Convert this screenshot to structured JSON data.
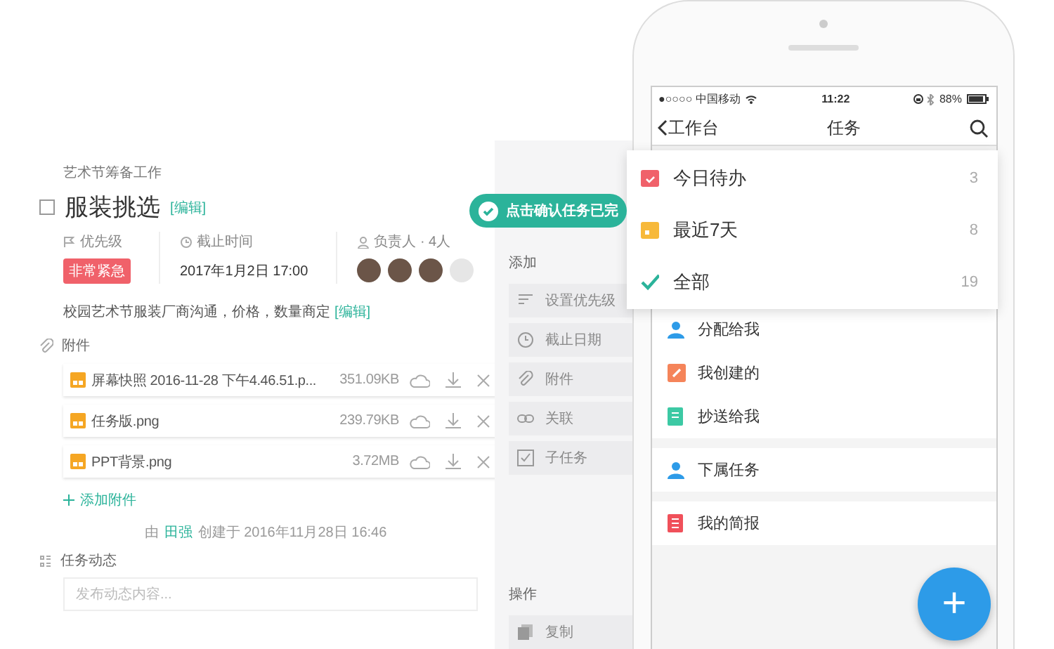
{
  "task_detail": {
    "breadcrumb": "艺术节筹备工作",
    "title": "服装挑选",
    "title_edit": "[编辑]",
    "completed": false,
    "fields": [
      {
        "kind": "priority",
        "label": "优先级",
        "value": "非常紧急"
      },
      {
        "kind": "deadline",
        "label": "截止时间",
        "value": "2017年1月2日 17:00"
      },
      {
        "kind": "assignees",
        "label": "负责人 · 4人",
        "avatars": [
          {
            "kind": "photo"
          },
          {
            "kind": "photo"
          },
          {
            "kind": "photo"
          },
          {
            "kind": "more"
          }
        ]
      }
    ],
    "description": "校园艺术节服装厂商沟通，价格，数量商定",
    "description_edit": "[编辑]",
    "attachments_label": "附件",
    "attachments": [
      {
        "name": "屏幕快照 2016-11-28 下午4.46.51.p...",
        "size": "351.09KB"
      },
      {
        "name": "任务版.png",
        "size": "239.79KB"
      },
      {
        "name": "PPT背景.png",
        "size": "3.72MB"
      }
    ],
    "add_attachment": "添加附件",
    "created_by": {
      "prefix": "由",
      "creator": "田强",
      "suffix": "创建于 2016年11月28日 16:46"
    },
    "activity_label": "任务动态",
    "activity_input": {
      "placeholder": "发布动态内容..."
    }
  },
  "side_panel": {
    "toast": "点击确认任务已完",
    "sections": [
      {
        "title": "添加",
        "items": [
          {
            "kind": "priority",
            "label": "设置优先级"
          },
          {
            "kind": "clock",
            "label": "截止日期"
          },
          {
            "kind": "clip",
            "label": "附件"
          },
          {
            "kind": "link",
            "label": "关联"
          },
          {
            "kind": "subtask",
            "label": "子任务"
          }
        ]
      },
      {
        "title": "操作",
        "items": [
          {
            "kind": "copy",
            "label": "复制"
          }
        ]
      }
    ]
  },
  "phone": {
    "status_bar": {
      "carrier": "●○○○○ 中国移动",
      "time": "11:22",
      "battery": "88%"
    },
    "nav": {
      "back": "工作台",
      "title": "任务"
    },
    "menu": [
      {
        "kind": "calendar",
        "label": "今日待办",
        "count": "3",
        "color": "#f0616a"
      },
      {
        "kind": "folder",
        "label": "最近7天",
        "count": "8",
        "color": "#f7b93a"
      },
      {
        "kind": "check",
        "label": "全部",
        "count": "19",
        "color": "#2bb39a"
      }
    ],
    "groups": [
      {
        "items": [
          {
            "kind": "person",
            "label": "分配给我",
            "color": "#2d9be8"
          },
          {
            "kind": "edit",
            "label": "我创建的",
            "color": "#f5845a"
          },
          {
            "kind": "doc",
            "label": "抄送给我",
            "color": "#3cc9a4"
          }
        ]
      },
      {
        "items": [
          {
            "kind": "person",
            "label": "下属任务",
            "color": "#2d9be8"
          }
        ]
      },
      {
        "items": [
          {
            "kind": "list",
            "label": "我的简报",
            "color": "#f0505a"
          }
        ]
      }
    ],
    "fab": "+"
  }
}
